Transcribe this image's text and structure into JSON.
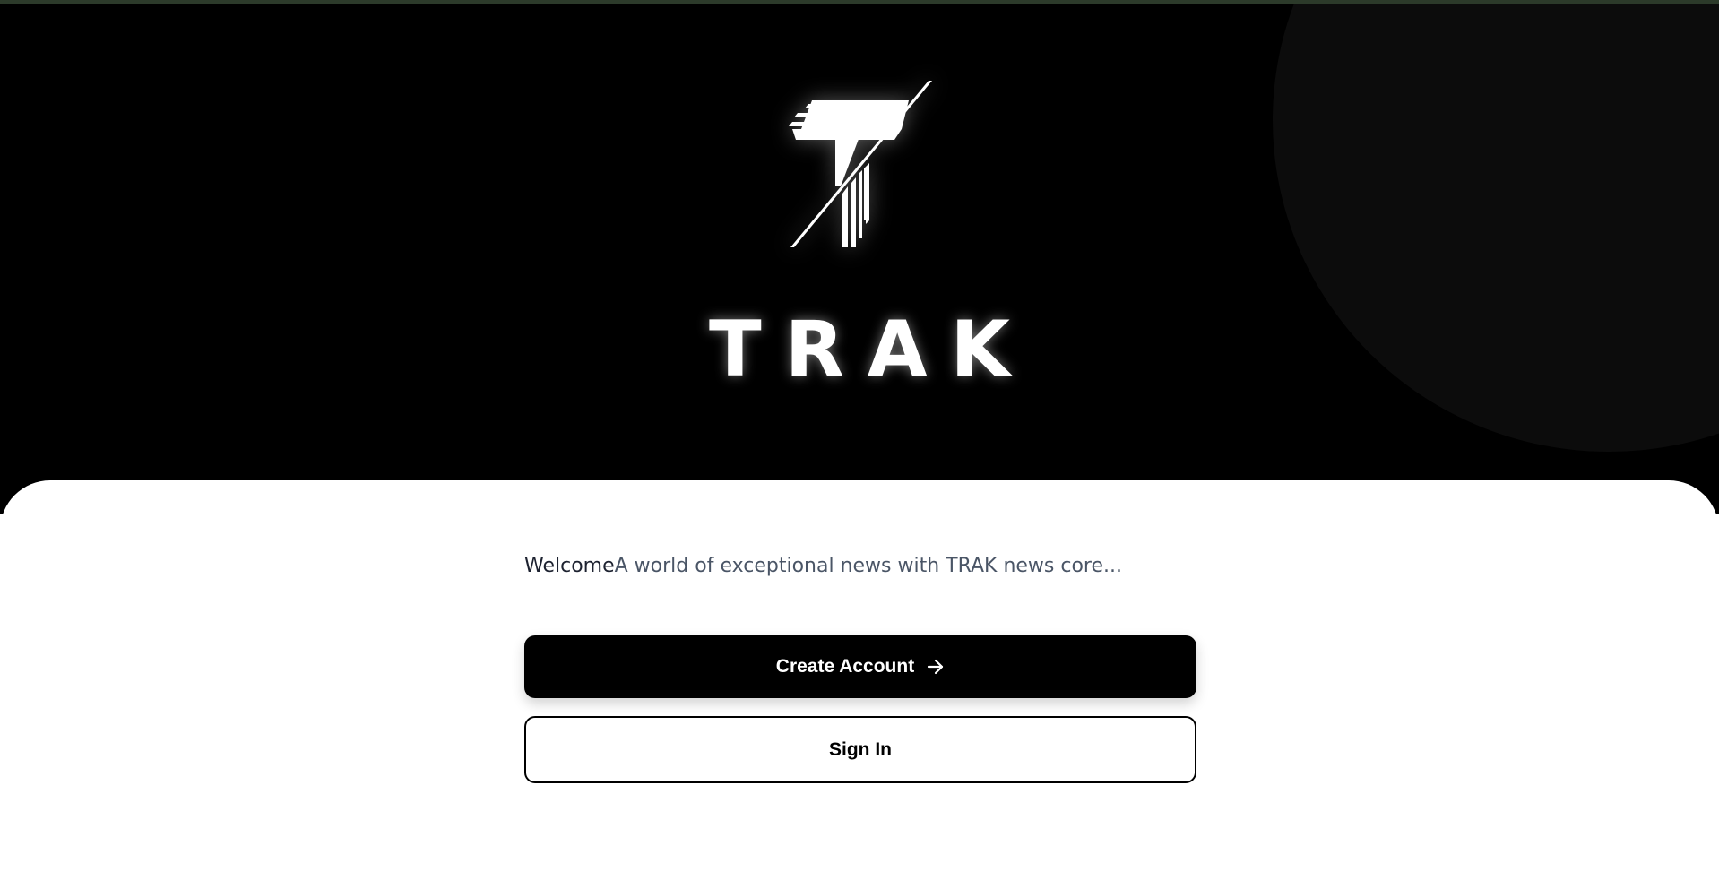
{
  "brand": {
    "name": "TRAK",
    "logo_icon": "trak-logo-mark"
  },
  "welcome": {
    "title": "Welcome",
    "subtitle": "A world of exceptional news with TRAK news core..."
  },
  "actions": {
    "create_account_label": "Create Account",
    "create_account_icon": "arrow-right-icon",
    "sign_in_label": "Sign In"
  },
  "colors": {
    "hero_background": "#000000",
    "panel_background": "#ffffff",
    "primary_button": "#000000",
    "primary_button_text": "#ffffff",
    "subtitle_text": "#4a5566"
  }
}
